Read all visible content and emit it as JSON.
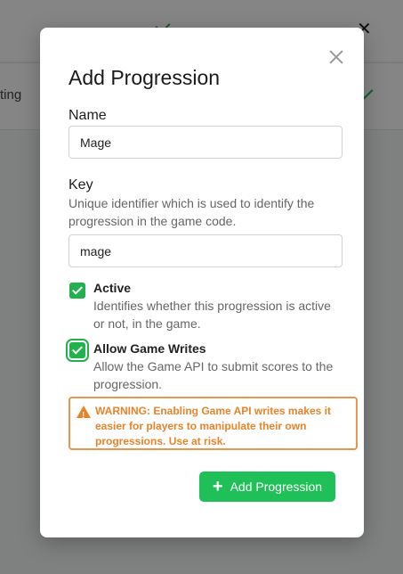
{
  "background": {
    "row_text": "ting"
  },
  "modal": {
    "title": "Add Progression",
    "name_label": "Name",
    "name_value": "Mage",
    "key_label": "Key",
    "key_help": "Unique identifier which is used to identify the progression in the game code.",
    "key_value": "mage",
    "active": {
      "label": "Active",
      "help": "Identifies whether this progression is active or not, in the game.",
      "checked": true
    },
    "allow_writes": {
      "label": "Allow Game Writes",
      "help": "Allow the Game API to submit scores to the progression.",
      "checked": true
    },
    "warning_text": "WARNING: Enabling Game API writes makes it easier for players to manipulate their own progressions. Use at risk.",
    "submit_label": "Add Progression",
    "accent_color": "#20c058",
    "warning_color": "#e9832a"
  }
}
